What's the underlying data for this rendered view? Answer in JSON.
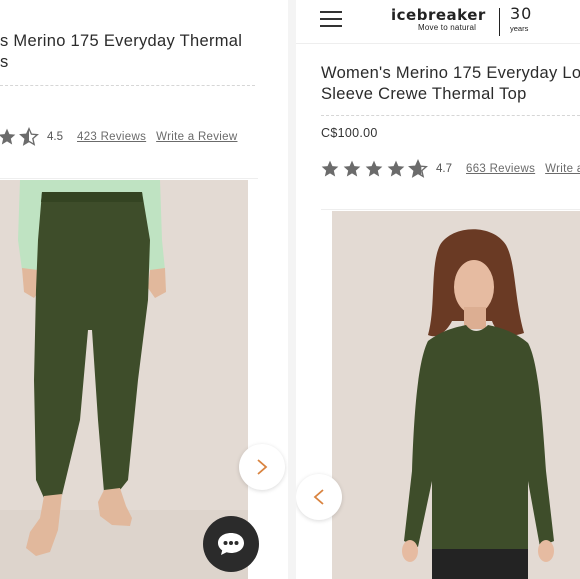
{
  "left": {
    "title_line1": "s Merino 175 Everyday Thermal",
    "title_line2": "s",
    "rating": "4.5",
    "reviews_link": "423 Reviews",
    "write_review": "Write a Review",
    "stars_filled": 2.5,
    "next_arrow": "chevron-right-icon"
  },
  "right": {
    "header": {
      "menu_icon": "hamburger-icon",
      "logo": "icebreaker",
      "logo_tagline": "Move to natural",
      "anniversary_number": "30",
      "anniversary_label": "years"
    },
    "title_line1": "Women's Merino 175 Everyday Lo",
    "title_line2": "Sleeve Crewe Thermal Top",
    "price": "C$100.00",
    "rating": "4.7",
    "reviews_link": "663 Reviews",
    "write_review": "Write a",
    "stars_filled": 4.7,
    "prev_arrow": "chevron-left-icon"
  },
  "chat": {
    "icon": "chat-bubble-icon"
  },
  "colors": {
    "product_green": "#3e4d2a",
    "star_gray": "#6b6b6b",
    "arrow_orange": "#d9833f",
    "photo_bg": "#e3dad3",
    "chat_bg": "#2b2b2b"
  }
}
